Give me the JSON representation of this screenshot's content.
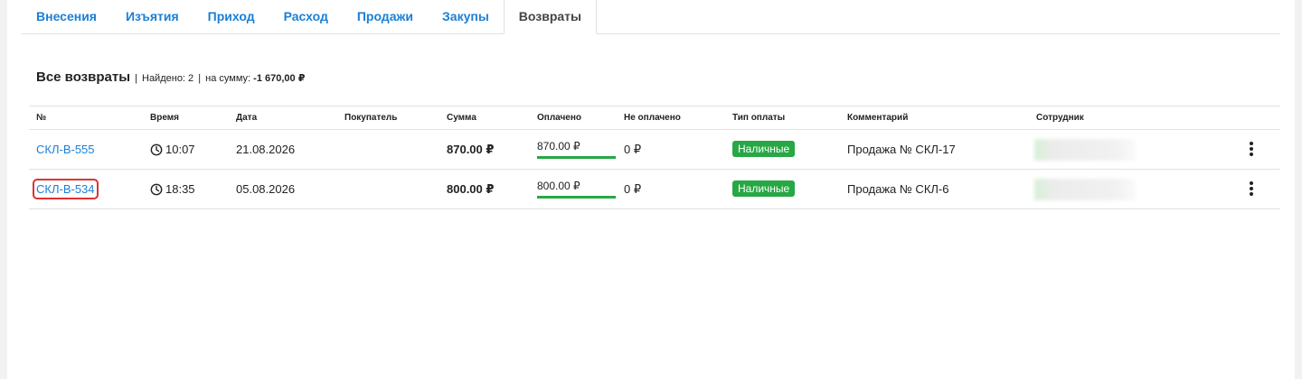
{
  "tabs": [
    {
      "label": "Внесения",
      "active": false
    },
    {
      "label": "Изъятия",
      "active": false
    },
    {
      "label": "Приход",
      "active": false
    },
    {
      "label": "Расход",
      "active": false
    },
    {
      "label": "Продажи",
      "active": false
    },
    {
      "label": "Закупы",
      "active": false
    },
    {
      "label": "Возвраты",
      "active": true
    }
  ],
  "summary": {
    "title": "Все возвраты",
    "found_label": "Найдено: 2",
    "sum_label": "на сумму:",
    "sum_value": "-1 670,00 ₽"
  },
  "table": {
    "headers": {
      "num": "№",
      "time": "Время",
      "date": "Дата",
      "buyer": "Покупатель",
      "sum": "Сумма",
      "paid": "Оплачено",
      "unpaid": "Не оплачено",
      "pay_type": "Тип оплаты",
      "comment": "Комментарий",
      "employee": "Сотрудник"
    },
    "rows": [
      {
        "id": "СКЛ-В-555",
        "time": "10:07",
        "date": "21.08.2026",
        "buyer": "",
        "sum": "870.00 ₽",
        "paid": "870.00 ₽",
        "unpaid": "0 ₽",
        "pay_type": "Наличные",
        "comment": "Продажа № СКЛ-17"
      },
      {
        "id": "СКЛ-В-534",
        "time": "18:35",
        "date": "05.08.2026",
        "buyer": "",
        "sum": "800.00 ₽",
        "paid": "800.00 ₽",
        "unpaid": "0 ₽",
        "pay_type": "Наличные",
        "comment": "Продажа № СКЛ-6"
      }
    ]
  },
  "colors": {
    "link": "#1a7fd6",
    "success": "#28a745",
    "highlight": "#e03131"
  },
  "icons": {
    "clock": "clock-icon",
    "menu": "kebab-menu-icon"
  }
}
